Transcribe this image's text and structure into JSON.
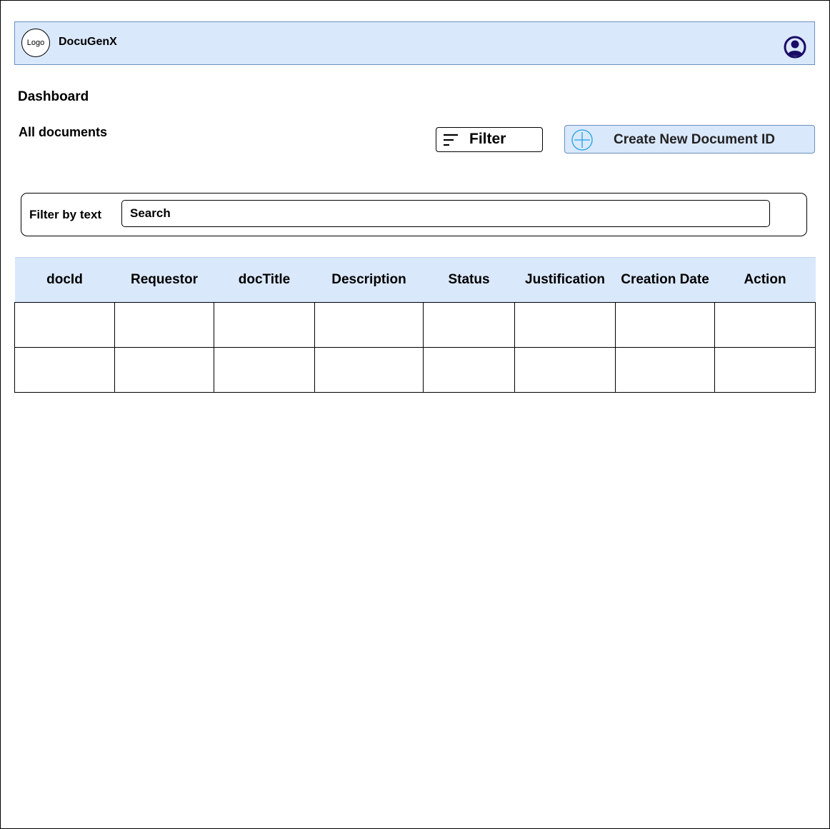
{
  "header": {
    "logo_text": "Logo",
    "app_name": "DocuGenX",
    "avatar_icon": "user-circle-icon"
  },
  "page": {
    "title": "Dashboard",
    "section_title": "All documents"
  },
  "toolbar": {
    "filter_label": "Filter",
    "filter_icon": "filter-lines-icon",
    "create_label": "Create New Document ID",
    "create_icon": "plus-circle-icon"
  },
  "search": {
    "label": "Filter by text",
    "placeholder": "Search",
    "value": ""
  },
  "table": {
    "columns": [
      "docId",
      "Requestor",
      "docTitle",
      "Description",
      "Status",
      "Justification",
      "Creation Date",
      "Action"
    ],
    "rows": [
      [
        "",
        "",
        "",
        "",
        "",
        "",
        "",
        ""
      ],
      [
        "",
        "",
        "",
        "",
        "",
        "",
        "",
        ""
      ]
    ]
  },
  "colors": {
    "accent_fill": "#dae8fc",
    "accent_border": "#6c8ebf",
    "avatar": "#1a0b66",
    "plus_icon": "#1ba1e2"
  }
}
